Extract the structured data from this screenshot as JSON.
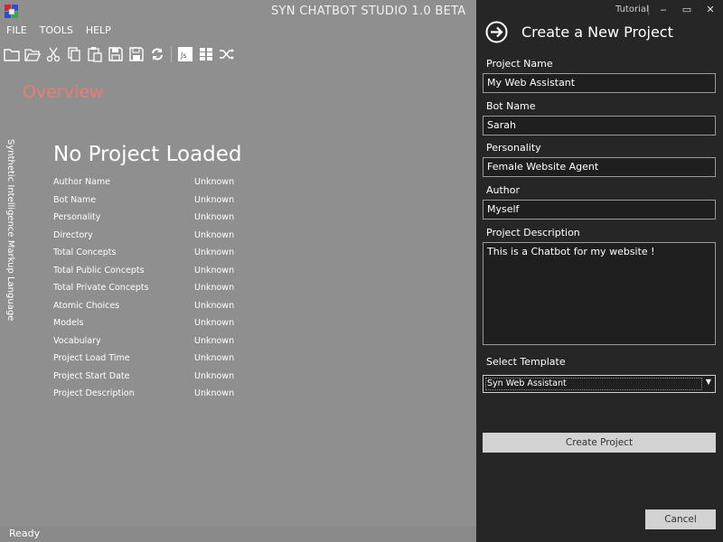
{
  "app": {
    "title": "SYN CHATBOT STUDIO 1.0 BETA",
    "logo_icon": "colored-cubes-logo"
  },
  "menu": [
    "FILE",
    "TOOLS",
    "HELP"
  ],
  "toolbar": {
    "icons": [
      "new-folder-icon",
      "open-folder-icon",
      "cut-icon",
      "copy-icon",
      "paste-icon",
      "save-icon",
      "save-as-icon",
      "sync-icon",
      "javascript-icon",
      "grid-icon",
      "shuffle-icon"
    ],
    "js_label": "Js"
  },
  "overview": {
    "title": "Overview",
    "side_label": "Synthetic Intelligence Markup Language",
    "heading": "No Project Loaded",
    "properties": [
      {
        "name": "Author Name",
        "value": "Unknown"
      },
      {
        "name": "Bot Name",
        "value": "Unknown"
      },
      {
        "name": "Personality",
        "value": "Unknown"
      },
      {
        "name": "Directory",
        "value": "Unknown"
      },
      {
        "name": "Total Concepts",
        "value": "Unknown"
      },
      {
        "name": "Total Public Concepts",
        "value": "Unknown"
      },
      {
        "name": "Total Private Concepts",
        "value": "Unknown"
      },
      {
        "name": "Atomic Choices",
        "value": "Unknown"
      },
      {
        "name": "Models",
        "value": "Unknown"
      },
      {
        "name": "Vocabulary",
        "value": "Unknown"
      },
      {
        "name": "Project Load Time",
        "value": "Unknown"
      },
      {
        "name": "Project Start Date",
        "value": "Unknown"
      },
      {
        "name": "Project Description",
        "value": "Unknown"
      }
    ]
  },
  "status": {
    "text": "Ready"
  },
  "panel": {
    "tutorial": "Tutorial",
    "window_buttons": {
      "minimize": "‒",
      "maximize": "▭",
      "close": "✕"
    },
    "title": "Create a New Project",
    "fields": {
      "project_name": {
        "label": "Project Name",
        "value": "My Web Assistant"
      },
      "bot_name": {
        "label": "Bot Name",
        "value": "Sarah"
      },
      "personality": {
        "label": "Personality",
        "value": "Female Website Agent"
      },
      "author": {
        "label": "Author",
        "value": "Myself"
      },
      "description": {
        "label": "Project Description",
        "value": "This is a Chatbot for my website !"
      }
    },
    "template": {
      "label": "Select Template",
      "value": "Syn Web Assistant"
    },
    "create_button": "Create Project",
    "cancel_button": "Cancel"
  },
  "colors": {
    "main_bg": "#8f8f8f",
    "panel_bg": "#262626",
    "accent_overview": "#e97d72",
    "button_bg": "#d2d2d2"
  }
}
